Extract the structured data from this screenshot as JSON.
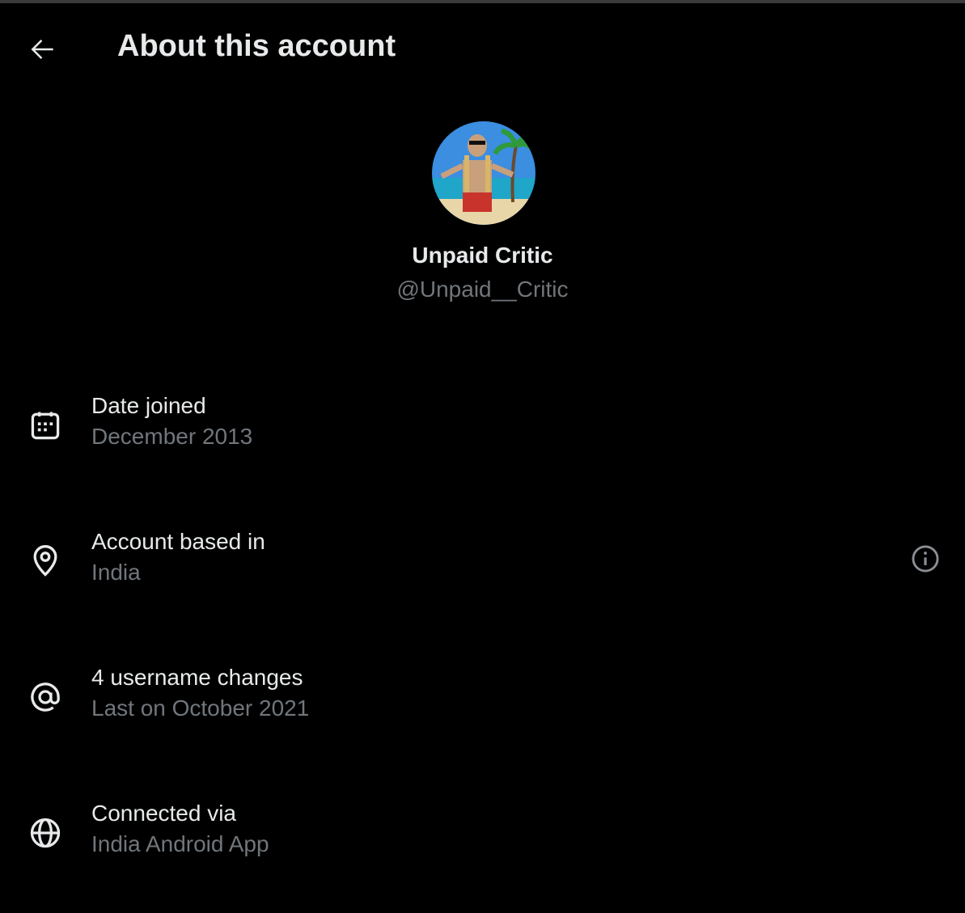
{
  "header": {
    "title": "About this account"
  },
  "profile": {
    "name": "Unpaid Critic",
    "handle": "@Unpaid__Critic"
  },
  "rows": [
    {
      "icon": "calendar-icon",
      "label": "Date joined",
      "value": "December 2013"
    },
    {
      "icon": "location-pin-icon",
      "label": "Account based in",
      "value": "India"
    },
    {
      "icon": "at-sign-icon",
      "label": "4 username changes",
      "value": "Last on October 2021"
    },
    {
      "icon": "globe-icon",
      "label": "Connected via",
      "value": "India Android App"
    }
  ]
}
